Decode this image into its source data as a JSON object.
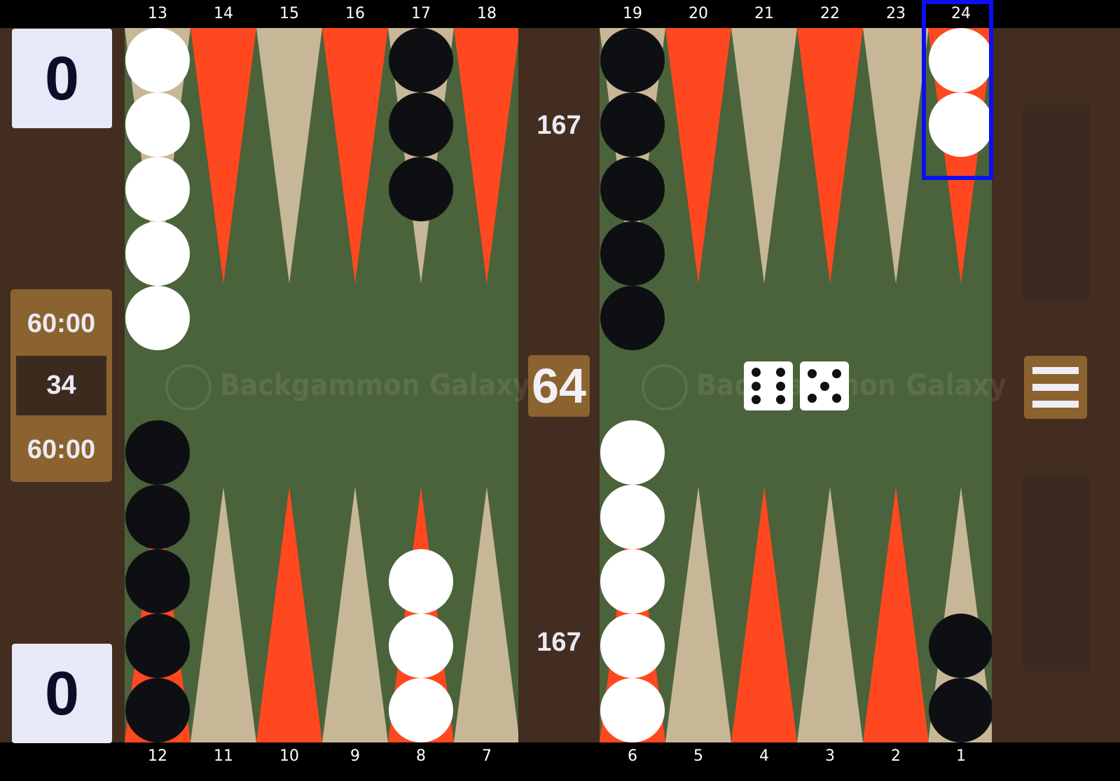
{
  "point_numbers_top": [
    "13",
    "14",
    "15",
    "16",
    "17",
    "18",
    "19",
    "20",
    "21",
    "22",
    "23",
    "24"
  ],
  "point_numbers_bottom": [
    "12",
    "11",
    "10",
    "9",
    "8",
    "7",
    "6",
    "5",
    "4",
    "3",
    "2",
    "1"
  ],
  "scores": {
    "top": "0",
    "bottom": "0"
  },
  "clocks": {
    "top": "60:00",
    "match_length": "34",
    "bottom": "60:00"
  },
  "pip_counts": {
    "top": "167",
    "bottom": "167"
  },
  "doubling_cube": "64",
  "dice": [
    6,
    5
  ],
  "watermark": "Backgammon Galaxy",
  "highlighted_point": "24",
  "colors": {
    "board": "#4a633a",
    "frame": "#422d20",
    "point_red": "#ff4820",
    "point_tan": "#c8b797",
    "checker_white": "#ffffff",
    "checker_black": "#0e0f13",
    "highlight": "#0a10f0"
  },
  "checkers": [
    {
      "point": "13",
      "color": "white",
      "count": 5
    },
    {
      "point": "17",
      "color": "black",
      "count": 3
    },
    {
      "point": "19",
      "color": "black",
      "count": 5
    },
    {
      "point": "24",
      "color": "white",
      "count": 2
    },
    {
      "point": "12",
      "color": "black",
      "count": 5
    },
    {
      "point": "8",
      "color": "white",
      "count": 3
    },
    {
      "point": "6",
      "color": "white",
      "count": 5
    },
    {
      "point": "1",
      "color": "black",
      "count": 2
    }
  ]
}
